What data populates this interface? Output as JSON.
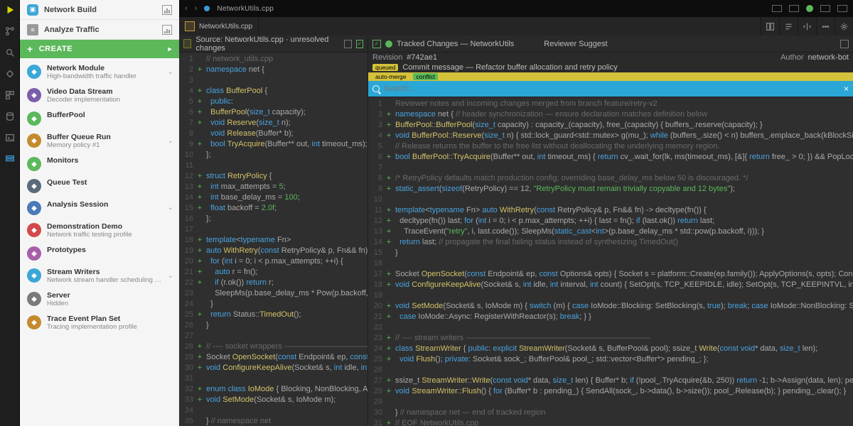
{
  "titlebar": {
    "title": "NetworkUtils.cpp"
  },
  "sidebar": {
    "top1": "Network Build",
    "top2": "Analyze Traffic",
    "create": "CREATE",
    "items": [
      {
        "color": "#3ba7d6",
        "title": "Network Module",
        "sub": "High-bandwidth traffic handler"
      },
      {
        "color": "#7a5fa8",
        "title": "Video Data Stream",
        "sub": "Decoder implementation"
      },
      {
        "color": "#5bb85b",
        "title": "BufferPool",
        "sub": ""
      },
      {
        "color": "#c48a2f",
        "title": "Buffer Queue Run",
        "sub": "Memory policy #1"
      },
      {
        "color": "#5bb85b",
        "title": "Monitors",
        "sub": ""
      },
      {
        "color": "#5a6a7a",
        "title": "Queue Test",
        "sub": ""
      },
      {
        "color": "#4a7ab8",
        "title": "Analysis Session",
        "sub": ""
      },
      {
        "color": "#d24a4a",
        "title": "Demonstration Demo",
        "sub": "Network traffic testing profile"
      },
      {
        "color": "#a85fa8",
        "title": "Prototypes",
        "sub": ""
      },
      {
        "color": "#3ba7d6",
        "title": "Stream Writers",
        "sub": "Network stream handler scheduling profile"
      },
      {
        "color": "#7a7a7a",
        "title": "Server",
        "sub": "Hidden"
      },
      {
        "color": "#c48a2f",
        "title": "Trace Event Plan Set",
        "sub": "Tracing implementation profile"
      }
    ]
  },
  "tabs": {
    "left": "NetworkUtils.cpp"
  },
  "leftPaneHead": "Source: NetworkUtils.cpp · unresolved changes",
  "rightPaneHead1": "Tracked Changes — NetworkUtils",
  "rightPaneHead2": "Reviewer Suggest",
  "diffMeta": {
    "row1a": "Revision",
    "row1b": "#742ae1",
    "row2a": "Commit message — Refactor buffer allocation and retry policy",
    "row3a": "Author",
    "row3b": "network-bot",
    "row4_tags": [
      "queued",
      "auto-merge",
      "conflict"
    ],
    "searchPlaceholder": "Search…"
  },
  "leftCode": [
    {
      "m": "",
      "t": "<span class='cm'>// network_utils.cpp</span>"
    },
    {
      "m": "+",
      "t": "<span class='kw'>namespace</span> net {"
    },
    {
      "m": "",
      "t": ""
    },
    {
      "m": "+",
      "t": "<span class='kw'>class</span> <span class='fn'>BufferPool</span> {"
    },
    {
      "m": "+",
      "t": "&nbsp;&nbsp;<span class='kw'>public</span>:"
    },
    {
      "m": "+",
      "t": "&nbsp;&nbsp;<span class='fn'>BufferPool</span>(<span class='kw'>size_t</span> capacity);"
    },
    {
      "m": "+",
      "t": "&nbsp;&nbsp;<span class='kw'>void</span> <span class='fn'>Reserve</span>(<span class='kw'>size_t</span> n);"
    },
    {
      "m": "",
      "t": "&nbsp;&nbsp;<span class='kw'>void</span> <span class='fn'>Release</span>(Buffer* b);"
    },
    {
      "m": "+",
      "t": "&nbsp;&nbsp;<span class='kw'>bool</span> <span class='fn'>TryAcquire</span>(Buffer** out, <span class='kw'>int</span> timeout_ms);"
    },
    {
      "m": "",
      "t": "};"
    },
    {
      "m": "",
      "t": ""
    },
    {
      "m": "+",
      "t": "<span class='kw'>struct</span> <span class='fn'>RetryPolicy</span> {"
    },
    {
      "m": "+",
      "t": "&nbsp;&nbsp;<span class='kw'>int</span> max_attempts = <span class='str'>5</span>;"
    },
    {
      "m": "+",
      "t": "&nbsp;&nbsp;<span class='kw'>int</span> base_delay_ms = <span class='str'>100</span>;"
    },
    {
      "m": "+",
      "t": "&nbsp;&nbsp;<span class='kw'>float</span> backoff = <span class='str'>2.0f</span>;"
    },
    {
      "m": "",
      "t": "};"
    },
    {
      "m": "",
      "t": ""
    },
    {
      "m": "+",
      "t": "<span class='kw'>template</span>&lt;<span class='kw'>typename</span> Fn&gt;"
    },
    {
      "m": "+",
      "t": "<span class='kw'>auto</span> <span class='fn'>WithRetry</span>(<span class='kw'>const</span> RetryPolicy&amp; p, Fn&amp;&amp; fn) {"
    },
    {
      "m": "+",
      "t": "&nbsp;&nbsp;<span class='kw'>for</span> (<span class='kw'>int</span> i = 0; i &lt; p.max_attempts; ++i) {"
    },
    {
      "m": "+",
      "t": "&nbsp;&nbsp;&nbsp;&nbsp;<span class='kw'>auto</span> r = fn();"
    },
    {
      "m": "+",
      "t": "&nbsp;&nbsp;&nbsp;&nbsp;<span class='kw'>if</span> (r.ok()) <span class='kw'>return</span> r;"
    },
    {
      "m": "",
      "t": "&nbsp;&nbsp;&nbsp;&nbsp;SleepMs(p.base_delay_ms * Pow(p.backoff, i));"
    },
    {
      "m": "",
      "t": "&nbsp;&nbsp;}"
    },
    {
      "m": "+",
      "t": "&nbsp;&nbsp;<span class='kw'>return</span> Status::<span class='fn'>TimedOut</span>();"
    },
    {
      "m": "",
      "t": "}"
    },
    {
      "m": "",
      "t": ""
    },
    {
      "m": "+",
      "t": "<span class='cm'>// ---- socket wrappers --------------------------------</span>"
    },
    {
      "m": "+",
      "t": "Socket <span class='fn'>OpenSocket</span>(<span class='kw'>const</span> Endpoint&amp; ep, <span class='kw'>const</span> Options&amp; opts);"
    },
    {
      "m": "+",
      "t": "<span class='kw'>void</span> <span class='fn'>ConfigureKeepAlive</span>(Socket&amp; s, <span class='kw'>int</span> idle, <span class='kw'>int</span> interval, <span class='kw'>int</span> count);"
    },
    {
      "m": "",
      "t": ""
    },
    {
      "m": "+",
      "t": "<span class='kw'>enum class</span> <span class='fn'>IoMode</span> { Blocking, NonBlocking, Async };"
    },
    {
      "m": "+",
      "t": "<span class='kw'>void</span> <span class='fn'>SetMode</span>(Socket&amp; s, IoMode m);"
    },
    {
      "m": "",
      "t": ""
    },
    {
      "m": "",
      "t": "} <span class='cm'>// namespace net</span>"
    }
  ],
  "rightCode": [
    {
      "m": "",
      "t": "<span class='cm'>Reviewer notes and incoming changes merged from branch feature/retry-v2</span>"
    },
    {
      "m": "+",
      "t": "<span class='kw'>namespace</span> net { <span class='cm'>// header synchronization — ensure declaration matches definition below</span>"
    },
    {
      "m": "+",
      "t": "<span class='fn'>BufferPool</span>::<span class='fn'>BufferPool</span>(<span class='kw'>size_t</span> capacity) : capacity_(capacity), free_(capacity) { buffers_.reserve(capacity); }"
    },
    {
      "m": "+",
      "t": "<span class='kw'>void</span> <span class='fn'>BufferPool</span>::<span class='fn'>Reserve</span>(<span class='kw'>size_t</span> n) { std::lock_guard&lt;std::mutex&gt; g(mu_); <span class='kw'>while</span> (buffers_.size() &lt; n) buffers_.emplace_back(kBlockSize); }"
    },
    {
      "m": "",
      "t": "<span class='cm'>// Release returns the buffer to the free list without deallocating the underlying memory region.</span>"
    },
    {
      "m": "+",
      "t": "<span class='kw'>bool</span> <span class='fn'>BufferPool</span>::<span class='fn'>TryAcquire</span>(Buffer** out, <span class='kw'>int</span> timeout_ms) { <span class='kw'>return</span> cv_.wait_for(lk, ms(timeout_ms), [&amp;]{ <span class='kw'>return</span> free_ &gt; 0; }) &amp;&amp; PopLocked(out); }"
    },
    {
      "m": "",
      "t": ""
    },
    {
      "m": "+",
      "t": "<span class='cm'>/* RetryPolicy defaults match production config; overriding base_delay_ms below 50 is discouraged. */</span>"
    },
    {
      "m": "+",
      "t": "<span class='kw'>static_assert</span>(<span class='kw'>sizeof</span>(RetryPolicy) == 12, <span class='str'>\"RetryPolicy must remain trivially copyable and 12 bytes\"</span>);"
    },
    {
      "m": "",
      "t": ""
    },
    {
      "m": "+",
      "t": "<span class='kw'>template</span>&lt;<span class='kw'>typename</span> Fn&gt; <span class='kw'>auto</span> <span class='fn'>WithRetry</span>(<span class='kw'>const</span> RetryPolicy&amp; p, Fn&amp;&amp; fn) -> decltype(fn()) {"
    },
    {
      "m": "+",
      "t": "&nbsp;&nbsp;decltype(fn()) last; <span class='kw'>for</span> (<span class='kw'>int</span> i = 0; i &lt; p.max_attempts; ++i) { last = fn(); <span class='kw'>if</span> (last.ok()) <span class='kw'>return</span> last;"
    },
    {
      "m": "+",
      "t": "&nbsp;&nbsp;&nbsp;&nbsp;TraceEvent(<span class='str'>\"retry\"</span>, i, last.code()); SleepMs(<span class='kw'>static_cast</span>&lt;<span class='kw'>int</span>&gt;(p.base_delay_ms * std::pow(p.backoff, i))); }"
    },
    {
      "m": "+",
      "t": "&nbsp;&nbsp;<span class='kw'>return</span> last; <span class='cm'>// propagate the final failing status instead of synthesizing TimedOut()</span>"
    },
    {
      "m": "",
      "t": "}"
    },
    {
      "m": "",
      "t": ""
    },
    {
      "m": "+",
      "t": "Socket <span class='fn'>OpenSocket</span>(<span class='kw'>const</span> Endpoint&amp; ep, <span class='kw'>const</span> Options&amp; opts) { Socket s = platform::Create(ep.family()); ApplyOptions(s, opts); Connect(s, ep); <span class='kw'>return</span> s; }"
    },
    {
      "m": "+",
      "t": "<span class='kw'>void</span> <span class='fn'>ConfigureKeepAlive</span>(Socket&amp; s, <span class='kw'>int</span> idle, <span class='kw'>int</span> interval, <span class='kw'>int</span> count) { SetOpt(s, TCP_KEEPIDLE, idle); SetOpt(s, TCP_KEEPINTVL, interval); SetOpt(s, TCP_KEEPCNT, count); }"
    },
    {
      "m": "",
      "t": ""
    },
    {
      "m": "+",
      "t": "<span class='kw'>void</span> <span class='fn'>SetMode</span>(Socket&amp; s, IoMode m) { <span class='kw'>switch</span> (m) { <span class='kw'>case</span> IoMode::Blocking: SetBlocking(s, <span class='kw'>true</span>); <span class='kw'>break</span>; <span class='kw'>case</span> IoMode::NonBlocking: SetBlocking(s, <span class='kw'>false</span>); <span class='kw'>break</span>;"
    },
    {
      "m": "+",
      "t": "&nbsp;&nbsp;<span class='kw'>case</span> IoMode::Async: RegisterWithReactor(s); <span class='kw'>break</span>; } }"
    },
    {
      "m": "",
      "t": ""
    },
    {
      "m": "+",
      "t": "<span class='cm'>// ---- stream writers -----------------------------------------------------------------------</span>"
    },
    {
      "m": "+",
      "t": "<span class='kw'>class</span> <span class='fn'>StreamWriter</span> { <span class='kw'>public</span>: <span class='kw'>explicit</span> <span class='fn'>StreamWriter</span>(Socket&amp; s, BufferPool&amp; pool); ssize_t <span class='fn'>Write</span>(<span class='kw'>const</span> <span class='kw'>void</span>* data, <span class='kw'>size_t</span> len);"
    },
    {
      "m": "+",
      "t": "&nbsp;&nbsp;<span class='kw'>void</span> <span class='fn'>Flush</span>(); <span class='kw'>private</span>: Socket&amp; sock_; BufferPool&amp; pool_; std::vector&lt;Buffer*&gt; pending_; };"
    },
    {
      "m": "",
      "t": ""
    },
    {
      "m": "+",
      "t": "ssize_t <span class='fn'>StreamWriter</span>::<span class='fn'>Write</span>(<span class='kw'>const</span> <span class='kw'>void</span>* data, <span class='kw'>size_t</span> len) { Buffer* b; <span class='kw'>if</span> (!pool_.TryAcquire(&amp;b, 250)) <span class='kw'>return</span> -1; b->Assign(data, len); pending_.push_back(b); <span class='kw'>return</span> len; }"
    },
    {
      "m": "+",
      "t": "<span class='kw'>void</span> <span class='fn'>StreamWriter</span>::<span class='fn'>Flush</span>() { <span class='kw'>for</span> (Buffer* b : pending_) { SendAll(sock_, b->data(), b->size()); pool_.Release(b); } pending_.clear(); }"
    },
    {
      "m": "",
      "t": ""
    },
    {
      "m": "",
      "t": "} <span class='cm'>// namespace net — end of tracked region</span>"
    },
    {
      "m": "+",
      "t": "<span class='cm'>// EOF NetworkUtils.cpp</span>"
    }
  ],
  "colors": {
    "accent": "#5bb85b",
    "link": "#3b99d8",
    "warn": "#d4c23a"
  }
}
